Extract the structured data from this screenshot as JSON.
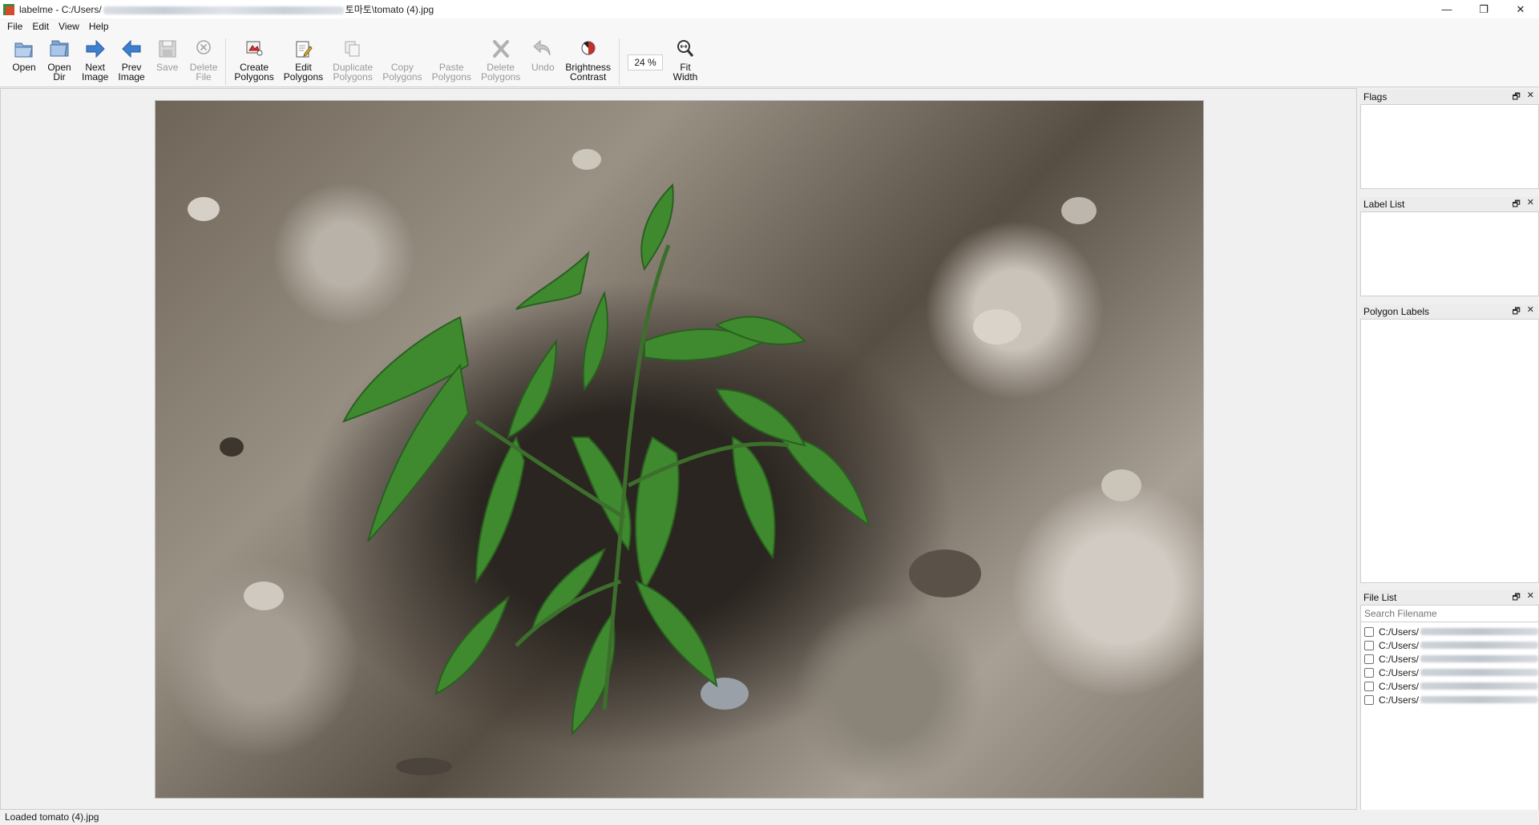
{
  "window": {
    "title_prefix": "labelme - C:/Users/",
    "title_suffix": "토마토\\tomato (4).jpg",
    "minimize": "—",
    "restore": "❐",
    "close": "✕"
  },
  "menu": {
    "file": "File",
    "edit": "Edit",
    "view": "View",
    "help": "Help"
  },
  "toolbar": {
    "open": "Open",
    "open_dir": "Open\nDir",
    "next_image": "Next\nImage",
    "prev_image": "Prev\nImage",
    "save": "Save",
    "delete_file": "Delete\nFile",
    "create_polygons": "Create\nPolygons",
    "edit_polygons": "Edit\nPolygons",
    "duplicate_polygons": "Duplicate\nPolygons",
    "copy_polygons": "Copy\nPolygons",
    "paste_polygons": "Paste\nPolygons",
    "delete_polygons": "Delete\nPolygons",
    "undo": "Undo",
    "brightness_contrast": "Brightness\nContrast",
    "zoom": "24 %",
    "fit_width": "Fit\nWidth"
  },
  "docks": {
    "flags": {
      "title": "Flags"
    },
    "label_list": {
      "title": "Label List"
    },
    "polygon_labels": {
      "title": "Polygon Labels"
    },
    "file_list": {
      "title": "File List",
      "search_placeholder": "Search Filename",
      "items": [
        "C:/Users/",
        "C:/Users/",
        "C:/Users/",
        "C:/Users/",
        "C:/Users/",
        "C:/Users/"
      ]
    },
    "float_button": "🗗",
    "close_button": "✕"
  },
  "status": {
    "message": "Loaded tomato (4).jpg"
  },
  "colors": {
    "accent_blue": "#3f7fd0",
    "leaf_green": "#3f8a2f",
    "soil_brown": "#7d7468"
  }
}
